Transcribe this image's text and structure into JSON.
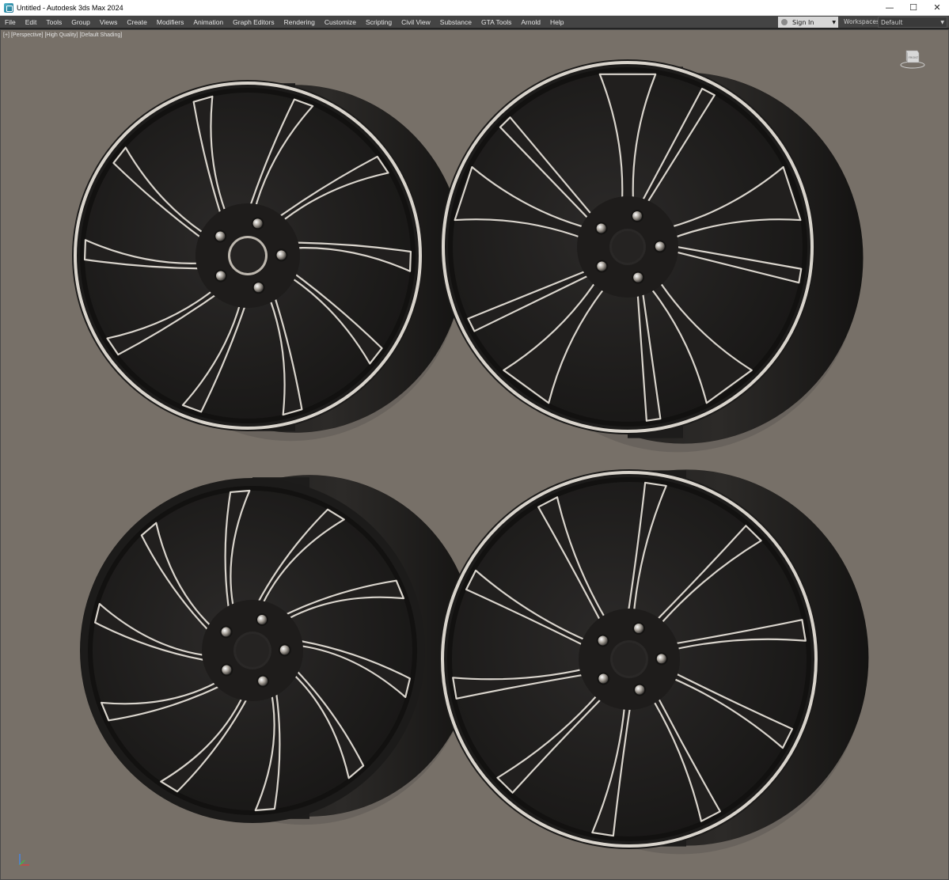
{
  "window": {
    "title": "Untitled - Autodesk 3ds Max 2024",
    "controls": {
      "minimize": "—",
      "maximize": "☐",
      "close": "✕"
    }
  },
  "menu": [
    "File",
    "Edit",
    "Tools",
    "Group",
    "Views",
    "Create",
    "Modifiers",
    "Animation",
    "Graph Editors",
    "Rendering",
    "Customize",
    "Scripting",
    "Civil View",
    "Substance",
    "GTA Tools",
    "Arnold",
    "Help"
  ],
  "account": {
    "sign_in": "Sign In",
    "chevron": "▼"
  },
  "workspaces": {
    "label": "Workspaces:",
    "value": "Default",
    "chevron": "▼"
  },
  "viewport": {
    "labels": [
      "[+]",
      "[Perspective]",
      "[High Quality]",
      "[Default Shading]"
    ],
    "viewcube_label": "FRONT",
    "background_color": "#777068"
  },
  "icons": {
    "app": "3ds-max-app-icon",
    "user": "user-icon",
    "viewcube": "viewcube-icon",
    "axis": "axis-tripod-icon"
  },
  "colors": {
    "titlebar": "#ffffff",
    "menubar": "#444444",
    "rim_dark": "#1c1b1a",
    "rim_face": "#2a2827",
    "machined": "#d9d4cc"
  }
}
